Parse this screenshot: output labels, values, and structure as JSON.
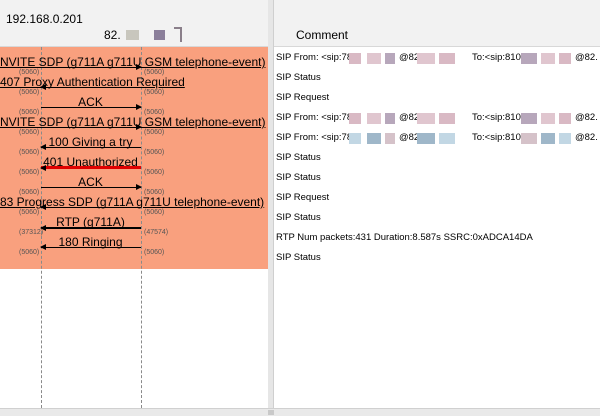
{
  "flow": {
    "host_a": "192.168.0.201",
    "host_b": "82.",
    "messages": [
      {
        "label": "NVITE SDP (g711A g711U GSM telephone-event)",
        "dir": "right",
        "style": "normal",
        "port_l": "(5060)",
        "port_r": "(5060)"
      },
      {
        "label": "407 Proxy Authentication Required",
        "dir": "left",
        "style": "normal",
        "port_l": "(5060)",
        "port_r": "(5060)"
      },
      {
        "label": "ACK",
        "dir": "right",
        "style": "normal",
        "port_l": "(5060)",
        "port_r": "(5060)"
      },
      {
        "label": "NVITE SDP (g711A g711U GSM telephone-event)",
        "dir": "right",
        "style": "normal",
        "port_l": "(5060)",
        "port_r": "(5060)"
      },
      {
        "label": "100 Giving a try",
        "dir": "left",
        "style": "normal",
        "port_l": "(5060)",
        "port_r": "(5060)"
      },
      {
        "label": "401 Unauthorized",
        "dir": "left",
        "style": "red",
        "port_l": "(5060)",
        "port_r": "(5060)"
      },
      {
        "label": "ACK",
        "dir": "right",
        "style": "normal",
        "port_l": "(5060)",
        "port_r": "(5060)"
      },
      {
        "label": "83 Progress SDP (g711A g711U telephone-event)",
        "dir": "left",
        "style": "normal",
        "port_l": "(5060)",
        "port_r": "(5060)"
      },
      {
        "label": "RTP (g711A)",
        "dir": "left",
        "style": "thick",
        "port_l": "(37312)",
        "port_r": "(47574)"
      },
      {
        "label": "180 Ringing",
        "dir": "left",
        "style": "normal",
        "port_l": "(5060)",
        "port_r": "(5060)"
      }
    ]
  },
  "comments": {
    "header": "Comment",
    "rows": [
      {
        "kind": "sip-from",
        "from": "SIP From: <sip:78",
        "at": "@82",
        "to": "To:<sip:810",
        "at2": "@82."
      },
      {
        "kind": "plain",
        "text": "SIP Status"
      },
      {
        "kind": "plain",
        "text": "SIP Request"
      },
      {
        "kind": "sip-from",
        "from": "SIP From: <sip:78",
        "at": "@82",
        "to": "To:<sip:810",
        "at2": "@82."
      },
      {
        "kind": "sip-from",
        "from": "SIP From: <sip:78",
        "at": "@82",
        "to": "To:<sip:810",
        "at2": "@82."
      },
      {
        "kind": "plain",
        "text": "SIP Status"
      },
      {
        "kind": "plain",
        "text": "SIP Status"
      },
      {
        "kind": "plain",
        "text": "SIP Request"
      },
      {
        "kind": "plain",
        "text": "SIP Status"
      },
      {
        "kind": "plain",
        "text": "RTP Num packets:431  Duration:8.587s SSRC:0xADCA14DA"
      },
      {
        "kind": "plain",
        "text": "SIP Status"
      }
    ]
  },
  "colors": {
    "flow_background": "#f9a07e",
    "unauthorized_arrow": "#e00000",
    "panel_header": "#f2f2f2"
  }
}
